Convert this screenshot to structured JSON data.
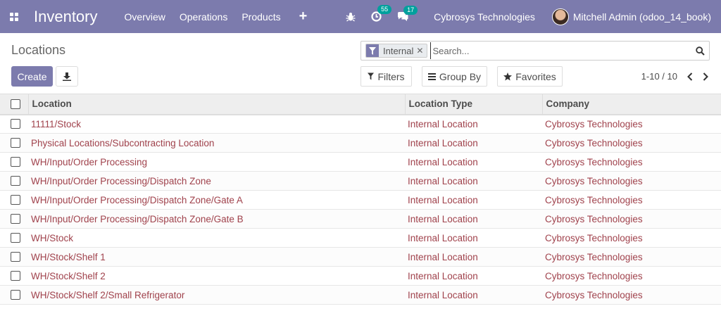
{
  "navbar": {
    "app_name": "Inventory",
    "menu": [
      "Overview",
      "Operations",
      "Products"
    ],
    "plus": "+",
    "activities_count": "55",
    "messages_count": "17",
    "company": "Cybrosys Technologies",
    "user": "Mitchell Admin (odoo_14_book)",
    "color": "#7c7bad"
  },
  "control": {
    "title": "Locations",
    "create_label": "Create",
    "search": {
      "facet_value": "Internal",
      "placeholder": "Search..."
    },
    "filters_label": "Filters",
    "groupby_label": "Group By",
    "favorites_label": "Favorites",
    "pager": "1-10 / 10"
  },
  "table": {
    "headers": [
      "Location",
      "Location Type",
      "Company"
    ],
    "rows": [
      {
        "location": "11111/Stock",
        "type": "Internal Location",
        "company": "Cybrosys Technologies"
      },
      {
        "location": "Physical Locations/Subcontracting Location",
        "type": "Internal Location",
        "company": "Cybrosys Technologies"
      },
      {
        "location": "WH/Input/Order Processing",
        "type": "Internal Location",
        "company": "Cybrosys Technologies"
      },
      {
        "location": "WH/Input/Order Processing/Dispatch Zone",
        "type": "Internal Location",
        "company": "Cybrosys Technologies"
      },
      {
        "location": "WH/Input/Order Processing/Dispatch Zone/Gate A",
        "type": "Internal Location",
        "company": "Cybrosys Technologies"
      },
      {
        "location": "WH/Input/Order Processing/Dispatch Zone/Gate B",
        "type": "Internal Location",
        "company": "Cybrosys Technologies"
      },
      {
        "location": "WH/Stock",
        "type": "Internal Location",
        "company": "Cybrosys Technologies"
      },
      {
        "location": "WH/Stock/Shelf 1",
        "type": "Internal Location",
        "company": "Cybrosys Technologies"
      },
      {
        "location": "WH/Stock/Shelf 2",
        "type": "Internal Location",
        "company": "Cybrosys Technologies"
      },
      {
        "location": "WH/Stock/Shelf 2/Small Refrigerator",
        "type": "Internal Location",
        "company": "Cybrosys Technologies"
      }
    ]
  }
}
